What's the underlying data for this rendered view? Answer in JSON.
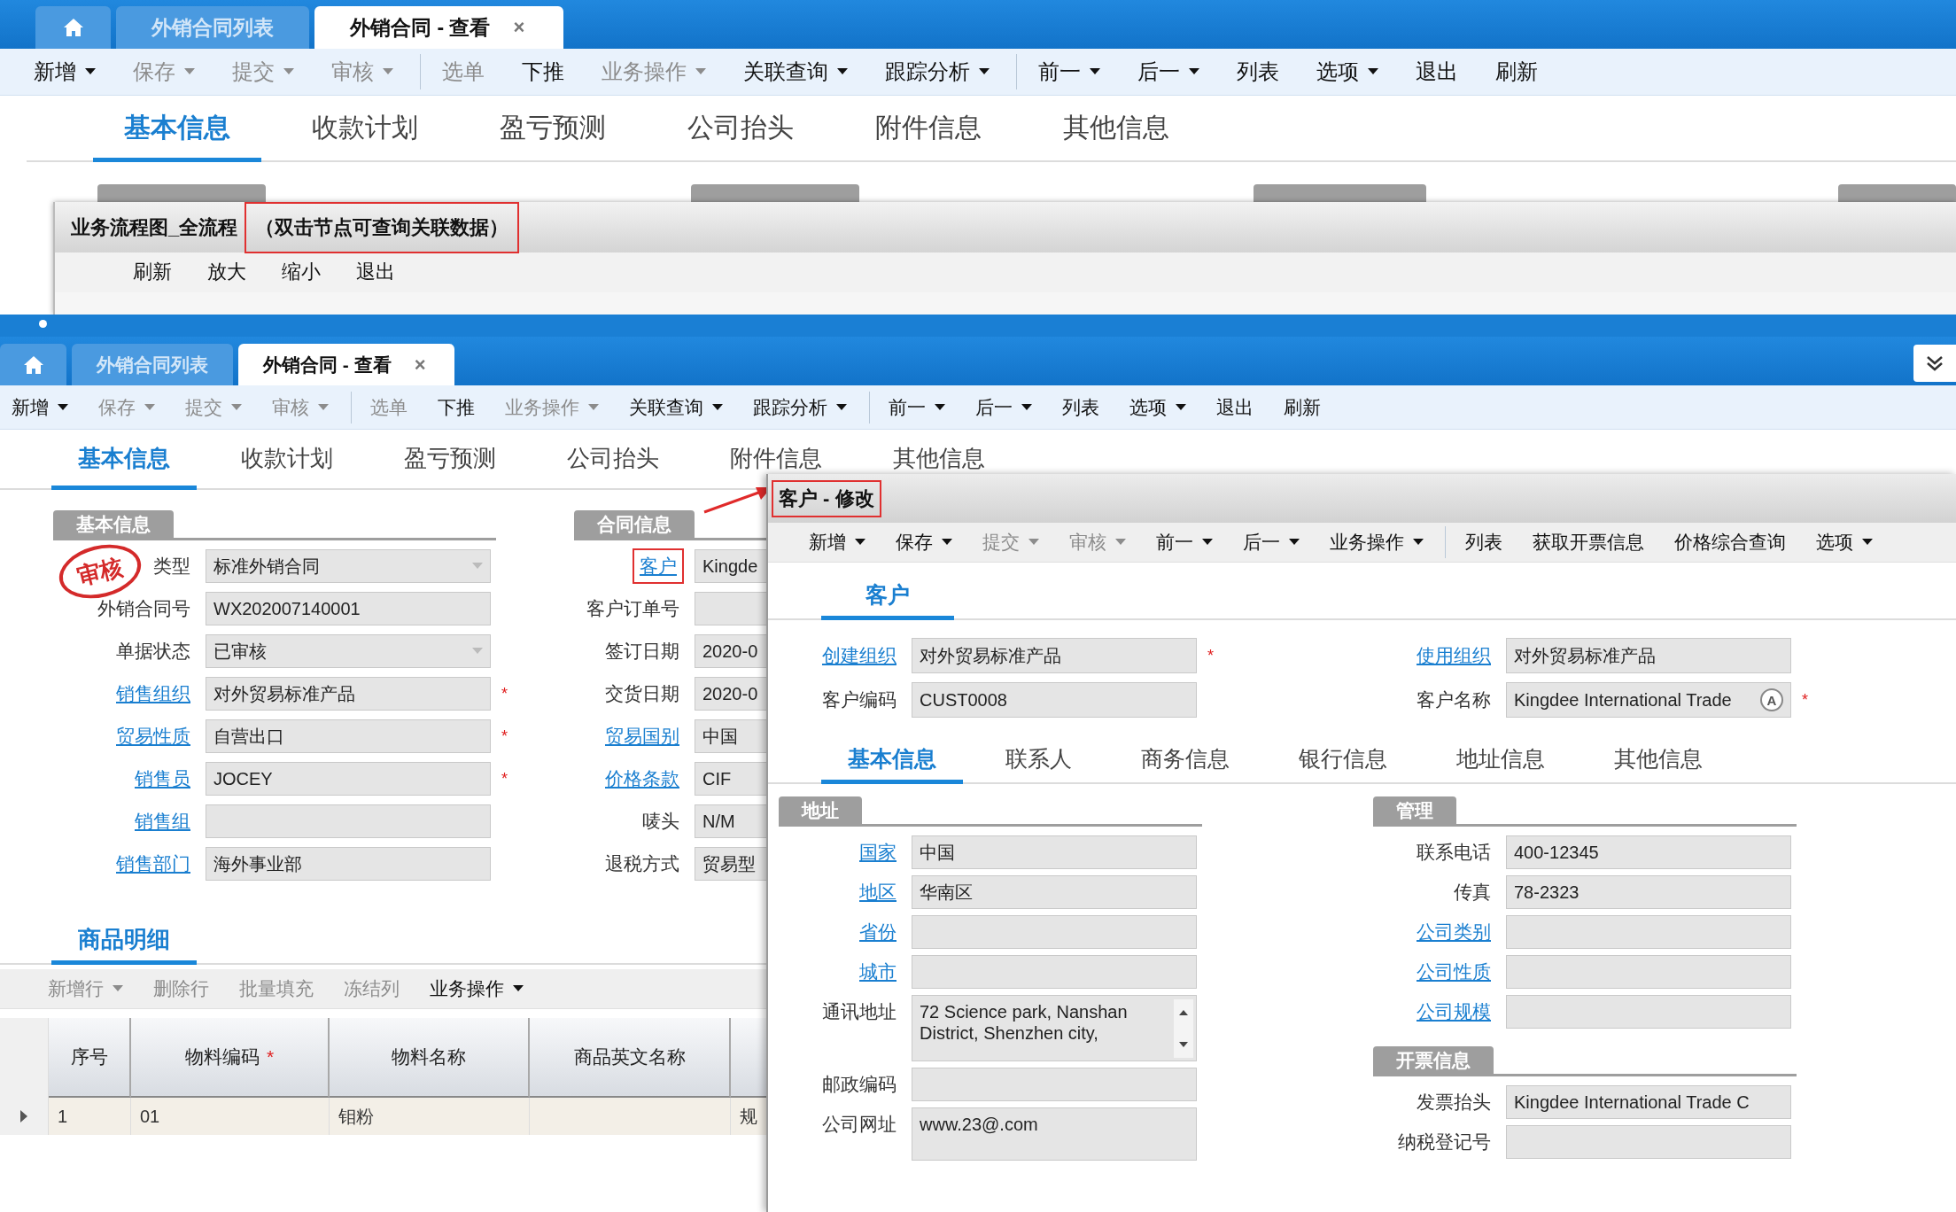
{
  "top_window": {
    "tabs": [
      {
        "kind": "home",
        "selected": false
      },
      {
        "kind": "page",
        "label": "外销合同列表",
        "selected": false
      },
      {
        "kind": "page",
        "label": "外销合同 - 查看",
        "close": "×",
        "selected": true
      }
    ],
    "toolbar": [
      {
        "label": "新增",
        "dropdown": true,
        "disabled": false,
        "group_start": false
      },
      {
        "label": "保存",
        "dropdown": true,
        "disabled": true,
        "group_start": false
      },
      {
        "label": "提交",
        "dropdown": true,
        "disabled": true,
        "group_start": false
      },
      {
        "label": "审核",
        "dropdown": true,
        "disabled": true,
        "group_start": false
      },
      {
        "label": "选单",
        "dropdown": false,
        "disabled": true,
        "group_start": true
      },
      {
        "label": "下推",
        "dropdown": false,
        "disabled": false,
        "group_start": false
      },
      {
        "label": "业务操作",
        "dropdown": true,
        "disabled": true,
        "group_start": false
      },
      {
        "label": "关联查询",
        "dropdown": true,
        "disabled": false,
        "group_start": false
      },
      {
        "label": "跟踪分析",
        "dropdown": true,
        "disabled": false,
        "group_start": false
      },
      {
        "label": "前一",
        "dropdown": true,
        "disabled": false,
        "group_start": true
      },
      {
        "label": "后一",
        "dropdown": true,
        "disabled": false,
        "group_start": false
      },
      {
        "label": "列表",
        "dropdown": false,
        "disabled": false,
        "group_start": false
      },
      {
        "label": "选项",
        "dropdown": true,
        "disabled": false,
        "group_start": false
      },
      {
        "label": "退出",
        "dropdown": false,
        "disabled": false,
        "group_start": false
      },
      {
        "label": "刷新",
        "dropdown": false,
        "disabled": false,
        "group_start": false
      }
    ],
    "section_tabs": [
      {
        "label": "基本信息",
        "selected": true
      },
      {
        "label": "收款计划",
        "selected": false
      },
      {
        "label": "盈亏预测",
        "selected": false
      },
      {
        "label": "公司抬头",
        "selected": false
      },
      {
        "label": "附件信息",
        "selected": false
      },
      {
        "label": "其他信息",
        "selected": false
      }
    ],
    "flow_dialog": {
      "title": "业务流程图_全流程",
      "hint": "（双击节点可查询关联数据）",
      "hint_highlighted": true,
      "toolbar": [
        {
          "label": "刷新"
        },
        {
          "label": "放大"
        },
        {
          "label": "缩小"
        },
        {
          "label": "退出"
        }
      ]
    }
  },
  "main_window": {
    "tabs": [
      {
        "kind": "home",
        "selected": false
      },
      {
        "kind": "page",
        "label": "外销合同列表",
        "selected": false
      },
      {
        "kind": "page",
        "label": "外销合同 - 查看",
        "close": "×",
        "selected": true
      }
    ],
    "toolbar": [
      {
        "label": "新增",
        "dropdown": true,
        "disabled": false,
        "group_start": false
      },
      {
        "label": "保存",
        "dropdown": true,
        "disabled": true,
        "group_start": false
      },
      {
        "label": "提交",
        "dropdown": true,
        "disabled": true,
        "group_start": false
      },
      {
        "label": "审核",
        "dropdown": true,
        "disabled": true,
        "group_start": false
      },
      {
        "label": "选单",
        "dropdown": false,
        "disabled": true,
        "group_start": true
      },
      {
        "label": "下推",
        "dropdown": false,
        "disabled": false,
        "group_start": false
      },
      {
        "label": "业务操作",
        "dropdown": true,
        "disabled": true,
        "group_start": false
      },
      {
        "label": "关联查询",
        "dropdown": true,
        "disabled": false,
        "group_start": false
      },
      {
        "label": "跟踪分析",
        "dropdown": true,
        "disabled": false,
        "group_start": false
      },
      {
        "label": "前一",
        "dropdown": true,
        "disabled": false,
        "group_start": true
      },
      {
        "label": "后一",
        "dropdown": true,
        "disabled": false,
        "group_start": false
      },
      {
        "label": "列表",
        "dropdown": false,
        "disabled": false,
        "group_start": false
      },
      {
        "label": "选项",
        "dropdown": true,
        "disabled": false,
        "group_start": false
      },
      {
        "label": "退出",
        "dropdown": false,
        "disabled": false,
        "group_start": false
      },
      {
        "label": "刷新",
        "dropdown": false,
        "disabled": false,
        "group_start": false
      }
    ],
    "section_tabs": [
      {
        "label": "基本信息",
        "selected": true
      },
      {
        "label": "收款计划",
        "selected": false
      },
      {
        "label": "盈亏预测",
        "selected": false
      },
      {
        "label": "公司抬头",
        "selected": false
      },
      {
        "label": "附件信息",
        "selected": false
      },
      {
        "label": "其他信息",
        "selected": false
      }
    ],
    "stamp": "审核",
    "sections": [
      {
        "title": "基本信息",
        "fields": [
          {
            "label": "类型",
            "kind": "select",
            "value": "标准外销合同",
            "link": false,
            "highlighted": false
          },
          {
            "label": "外销合同号",
            "kind": "text",
            "value": "WX202007140001",
            "link": false,
            "highlighted": false
          },
          {
            "label": "单据状态",
            "kind": "select",
            "value": "已审核",
            "link": false,
            "highlighted": false
          },
          {
            "label": "销售组织",
            "kind": "text",
            "value": "对外贸易标准产品",
            "link": true,
            "required_mark": "*",
            "highlighted": false
          },
          {
            "label": "贸易性质",
            "kind": "text",
            "value": "自营出口",
            "link": true,
            "required_mark": "*",
            "highlighted": false
          },
          {
            "label": "销售员",
            "kind": "text",
            "value": "JOCEY",
            "link": true,
            "required_mark": "*",
            "highlighted": false
          },
          {
            "label": "销售组",
            "kind": "text",
            "link": true,
            "highlighted": false
          },
          {
            "label": "销售部门",
            "kind": "text",
            "value": "海外事业部",
            "link": true,
            "highlighted": false
          }
        ]
      },
      {
        "title": "合同信息",
        "fields": [
          {
            "label": "客户",
            "kind": "text",
            "value": "Kingde",
            "link": true,
            "highlighted": true
          },
          {
            "label": "客户订单号",
            "kind": "text",
            "link": false,
            "highlighted": false
          },
          {
            "label": "签订日期",
            "kind": "text",
            "value": "2020-0",
            "link": false,
            "highlighted": false
          },
          {
            "label": "交货日期",
            "kind": "text",
            "value": "2020-0",
            "link": false,
            "highlighted": false
          },
          {
            "label": "贸易国别",
            "kind": "text",
            "value": "中国",
            "link": true,
            "highlighted": false
          },
          {
            "label": "价格条款",
            "kind": "text",
            "value": "CIF",
            "link": true,
            "highlighted": false
          },
          {
            "label": "唛头",
            "kind": "text",
            "value": "N/M",
            "link": false,
            "highlighted": false
          },
          {
            "label": "退税方式",
            "kind": "text",
            "value": "贸易型",
            "link": false,
            "highlighted": false
          }
        ]
      }
    ],
    "detail": {
      "tabs": [
        {
          "label": "商品明细",
          "selected": true
        }
      ],
      "toolbar": [
        {
          "label": "新增行",
          "dropdown": true,
          "disabled": true,
          "group_start": false
        },
        {
          "label": "删除行",
          "dropdown": false,
          "disabled": true,
          "group_start": false
        },
        {
          "label": "批量填充",
          "dropdown": false,
          "disabled": true,
          "group_start": false
        },
        {
          "label": "冻结列",
          "dropdown": false,
          "disabled": true,
          "group_start": false
        },
        {
          "label": "业务操作",
          "dropdown": true,
          "disabled": false,
          "group_start": false
        }
      ],
      "columns": [
        {
          "label": "序号"
        },
        {
          "label": "物料编码",
          "required_mark": "*"
        },
        {
          "label": "物料名称"
        },
        {
          "label": "商品英文名称"
        }
      ],
      "rows": [
        {
          "number": "1",
          "material_code": "01",
          "material_name": "钼粉",
          "column_5": "规"
        }
      ]
    }
  },
  "customer_dialog": {
    "title": "客户 - 修改",
    "title_highlighted": true,
    "toolbar": [
      {
        "label": "新增",
        "dropdown": true,
        "disabled": false,
        "group_start": false
      },
      {
        "label": "保存",
        "dropdown": true,
        "disabled": false,
        "group_start": false
      },
      {
        "label": "提交",
        "dropdown": true,
        "disabled": true,
        "group_start": false
      },
      {
        "label": "审核",
        "dropdown": true,
        "disabled": true,
        "group_start": false
      },
      {
        "label": "前一",
        "dropdown": true,
        "disabled": false,
        "group_start": false
      },
      {
        "label": "后一",
        "dropdown": true,
        "disabled": false,
        "group_start": false
      },
      {
        "label": "业务操作",
        "dropdown": true,
        "disabled": false,
        "group_start": false
      },
      {
        "label": "列表",
        "dropdown": false,
        "disabled": false,
        "group_start": true
      },
      {
        "label": "获取开票信息",
        "dropdown": false,
        "disabled": false,
        "group_start": false
      },
      {
        "label": "价格综合查询",
        "dropdown": false,
        "disabled": false,
        "group_start": false
      },
      {
        "label": "选项",
        "dropdown": true,
        "disabled": false,
        "group_start": false
      }
    ],
    "tabs": [
      {
        "label": "客户",
        "selected": true
      }
    ],
    "header_fields": [
      {
        "label": "创建组织",
        "kind": "text",
        "value": "对外贸易标准产品",
        "link": true,
        "required_mark": "*",
        "highlighted": false
      },
      {
        "label": "使用组织",
        "kind": "text",
        "value": "对外贸易标准产品",
        "link": true,
        "highlighted": false
      },
      {
        "label": "客户编码",
        "kind": "text",
        "value": "CUST0008",
        "link": false,
        "highlighted": false
      },
      {
        "label": "客户名称",
        "kind": "text",
        "value": "Kingdee International Trade",
        "badge": "A",
        "link": false,
        "required_mark": "*",
        "highlighted": false
      }
    ],
    "section_tabs": [
      {
        "label": "基本信息",
        "selected": true
      },
      {
        "label": "联系人",
        "selected": false
      },
      {
        "label": "商务信息",
        "selected": false
      },
      {
        "label": "银行信息",
        "selected": false
      },
      {
        "label": "地址信息",
        "selected": false
      },
      {
        "label": "其他信息",
        "selected": false
      }
    ],
    "left_sections": [
      {
        "title": "地址",
        "fields": [
          {
            "label": "国家",
            "kind": "text",
            "value": "中国",
            "link": true,
            "highlighted": false
          },
          {
            "label": "地区",
            "kind": "text",
            "value": "华南区",
            "link": true,
            "highlighted": false
          },
          {
            "label": "省份",
            "kind": "text",
            "link": true,
            "highlighted": false
          },
          {
            "label": "城市",
            "kind": "text",
            "link": true,
            "highlighted": false
          },
          {
            "label": "通讯地址",
            "kind": "textarea",
            "scrollbar": true,
            "value": "72 Science park, Nanshan District, Shenzhen city,",
            "link": false,
            "highlighted": false
          },
          {
            "label": "邮政编码",
            "kind": "text",
            "link": false,
            "highlighted": false
          },
          {
            "label": "公司网址",
            "kind": "textarea",
            "scrollbar": false,
            "value": "www.23@.com",
            "link": false,
            "highlighted": false
          }
        ]
      }
    ],
    "right_sections": [
      {
        "title": "管理",
        "fields": [
          {
            "label": "联系电话",
            "kind": "text",
            "value": "400-12345",
            "link": false,
            "highlighted": false
          },
          {
            "label": "传真",
            "kind": "text",
            "value": "78-2323",
            "link": false,
            "highlighted": false
          },
          {
            "label": "公司类别",
            "kind": "text",
            "link": true,
            "highlighted": false
          },
          {
            "label": "公司性质",
            "kind": "text",
            "link": true,
            "highlighted": false
          },
          {
            "label": "公司规模",
            "kind": "text",
            "link": true,
            "highlighted": false
          }
        ]
      },
      {
        "title": "开票信息",
        "fields": [
          {
            "label": "发票抬头",
            "kind": "text",
            "value": "Kingdee International Trade C",
            "link": false,
            "highlighted": false
          },
          {
            "label": "纳税登记号",
            "kind": "text",
            "link": false,
            "highlighted": false
          }
        ]
      }
    ]
  }
}
